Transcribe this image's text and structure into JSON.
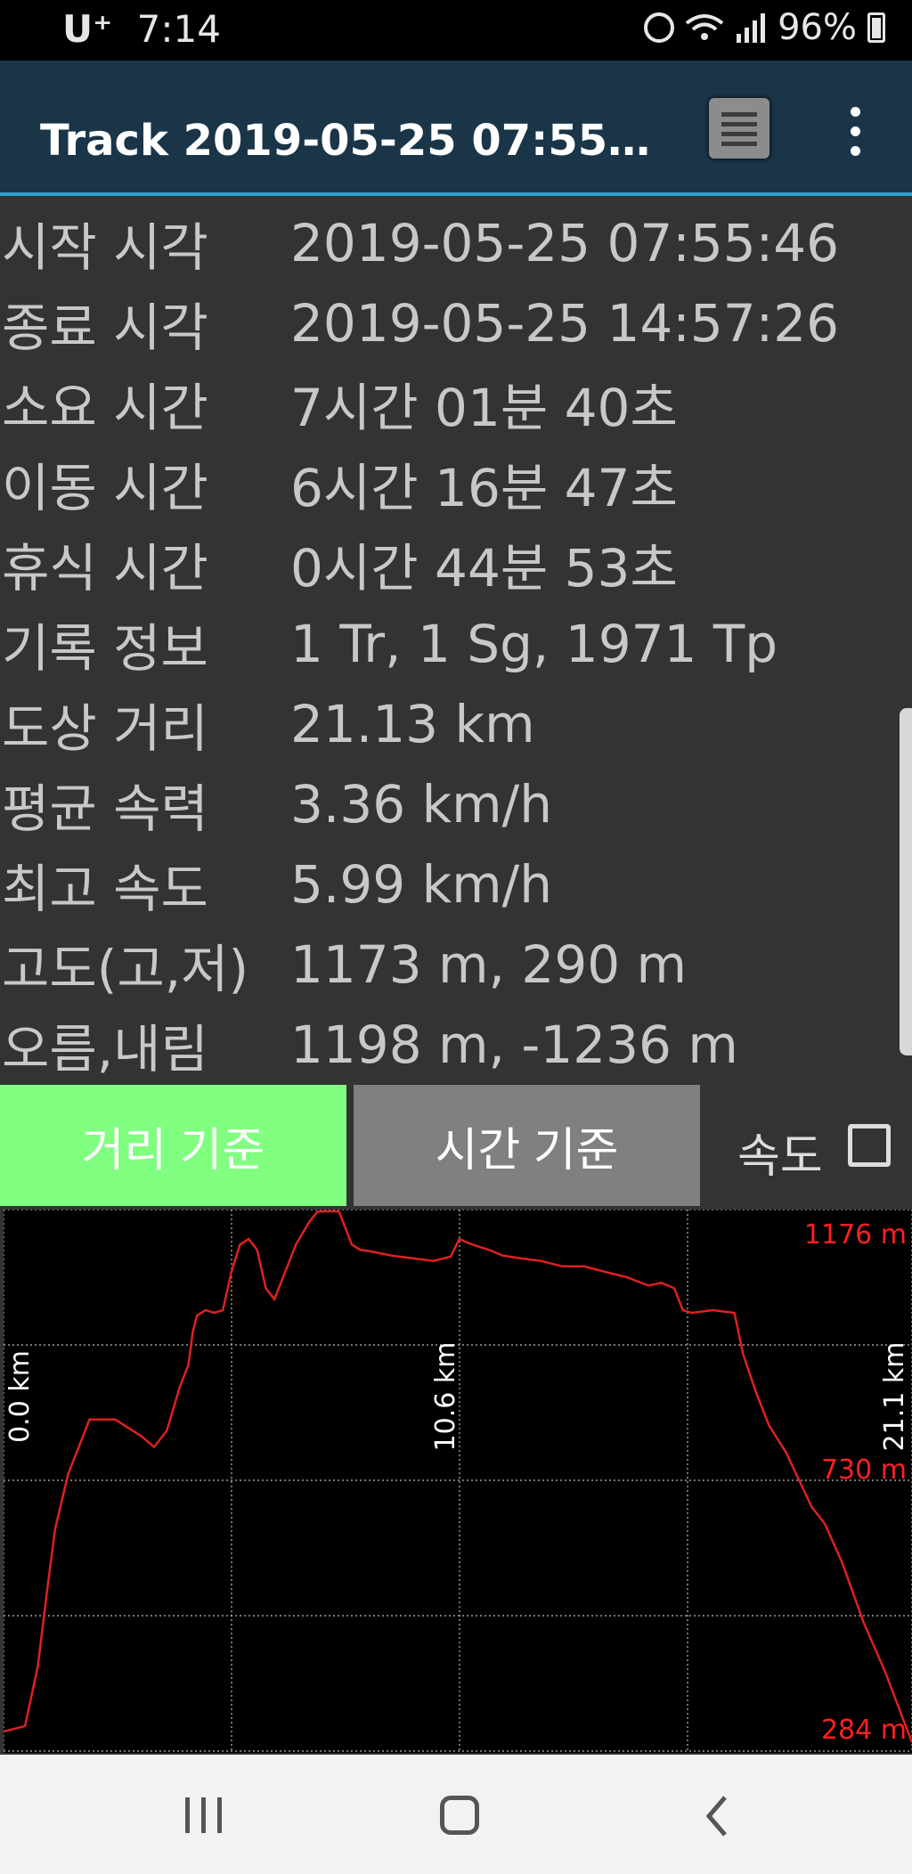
{
  "status_bar": {
    "carrier": "U⁺",
    "time": "7:14",
    "battery": "96%",
    "icons": [
      "alarm-icon",
      "wifi-icon",
      "signal-icon",
      "battery-icon"
    ]
  },
  "app_bar": {
    "title": "Track 2019-05-25 07:55간…",
    "list_icon": "list-icon",
    "more_icon": "more-vertical-icon"
  },
  "info": [
    {
      "label": "시작 시각",
      "value": "2019-05-25 07:55:46"
    },
    {
      "label": "종료 시각",
      "value": "2019-05-25 14:57:26"
    },
    {
      "label": "소요 시간",
      "value": "7시간 01분 40초"
    },
    {
      "label": "이동 시간",
      "value": "6시간 16분 47초"
    },
    {
      "label": "휴식 시간",
      "value": "0시간 44분 53초"
    },
    {
      "label": "기록 정보",
      "value": "1 Tr, 1 Sg, 1971 Tp"
    },
    {
      "label": "도상 거리",
      "value": "21.13 km"
    },
    {
      "label": "평균 속력",
      "value": "3.36 km/h"
    },
    {
      "label": "최고 속도",
      "value": "5.99 km/h"
    },
    {
      "label": "고도(고,저)",
      "value": "1173 m, 290 m"
    },
    {
      "label": "오름,내림",
      "value": "1198 m, -1236 m"
    }
  ],
  "toggle": {
    "distance_label": "거리 기준",
    "time_label": "시간 기준",
    "speed_label": "속도",
    "speed_checked": false
  },
  "chart_data": {
    "type": "line",
    "x_tick_labels": [
      "0.0 km",
      "10.6 km",
      "21.1 km"
    ],
    "y_tick_labels": [
      "1176 m",
      "730 m",
      "284 m"
    ],
    "xlim": [
      0,
      21.13
    ],
    "ylim": [
      284,
      1176
    ],
    "grid": true,
    "line_color": "#e02020",
    "label_color": "#ff2020",
    "series": [
      {
        "x": [
          0.0,
          0.5,
          0.8,
          1.0,
          1.2,
          1.5,
          2.0,
          2.6,
          3.2,
          3.5,
          3.8,
          4.1,
          4.3,
          4.4,
          4.5,
          4.7,
          4.9,
          5.1,
          5.3,
          5.5,
          5.7,
          5.9,
          6.1,
          6.3,
          6.5,
          6.8,
          7.1,
          7.3,
          7.5,
          7.8,
          8.1,
          8.3,
          8.5,
          8.7,
          9.0,
          9.5,
          10.0,
          10.4,
          10.6,
          10.9,
          11.1,
          11.3,
          11.6,
          12.0,
          12.5,
          13.0,
          13.5,
          14.0,
          14.5,
          15.0,
          15.3,
          15.6,
          15.8,
          16.0,
          16.5,
          17.0,
          17.2,
          17.5,
          17.8,
          18.2,
          18.5,
          18.8,
          19.1,
          19.5,
          20.0,
          20.5,
          21.13
        ],
        "y": [
          310,
          320,
          430,
          560,
          680,
          780,
          880,
          880,
          850,
          830,
          860,
          940,
          980,
          1040,
          1070,
          1080,
          1075,
          1080,
          1150,
          1200,
          1210,
          1190,
          1120,
          1100,
          1140,
          1200,
          1240,
          1260,
          1270,
          1265,
          1200,
          1190,
          1188,
          1185,
          1180,
          1175,
          1170,
          1178,
          1210,
          1200,
          1195,
          1190,
          1180,
          1175,
          1170,
          1160,
          1160,
          1150,
          1140,
          1125,
          1130,
          1120,
          1080,
          1075,
          1080,
          1075,
          1000,
          930,
          870,
          820,
          770,
          720,
          690,
          620,
          510,
          420,
          290
        ],
        "y_note": "elevation read from gridlines; values near peak estimated"
      }
    ]
  },
  "nav_bar": {
    "recents_icon": "recents-icon",
    "home_icon": "home-icon",
    "back_icon": "back-icon"
  }
}
